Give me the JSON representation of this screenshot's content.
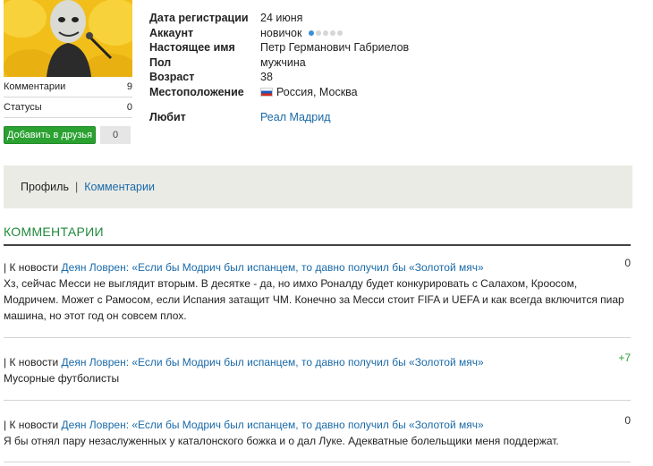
{
  "profile": {
    "stats": [
      {
        "label": "Комментарии",
        "value": "9"
      },
      {
        "label": "Статусы",
        "value": "0"
      }
    ],
    "add_friend_label": "Добавить в друзья",
    "add_friend_count": "0",
    "info": [
      {
        "key": "Дата регистрации",
        "value": "24 июня"
      },
      {
        "key": "Аккаунт",
        "value": "новичок"
      },
      {
        "key": "Настоящее имя",
        "value": "Петр Германович Габриелов"
      },
      {
        "key": "Пол",
        "value": "мужчина"
      },
      {
        "key": "Возраст",
        "value": "38"
      },
      {
        "key": "Местоположение",
        "value": "Россия, Москва"
      }
    ],
    "account_level": {
      "filled": 1,
      "total": 5
    },
    "likes_label": "Любит",
    "likes_value": "Реал Мадрид",
    "colors": {
      "accent_green": "#2aa131",
      "link_blue": "#1a6aa8"
    }
  },
  "tabs": {
    "profile": "Профиль",
    "separator": "|",
    "comments": "Комментарии"
  },
  "section_title": "КОММЕНТАРИИ",
  "comments": [
    {
      "prefix": "| К новости",
      "link": "Деян Ловрен: «Если бы Модрич был испанцем, то давно получил бы «Золотой мяч»",
      "text": "Хз, сейчас Месси не выглядит вторым. В десятке - да, но имхо Роналду будет конкурировать с Салахом, Кроосом, Модричем. Может с Рамосом, если Испания затащит ЧМ. Конечно за Месси стоит FIFA и UEFA и как всегда включится пиар машина, но этот год он совсем плох.",
      "score": "0"
    },
    {
      "prefix": "| К новости",
      "link": "Деян Ловрен: «Если бы Модрич был испанцем, то давно получил бы «Золотой мяч»",
      "text": "Мусорные футболисты",
      "score": "+7"
    },
    {
      "prefix": "| К новости",
      "link": "Деян Ловрен: «Если бы Модрич был испанцем, то давно получил бы «Золотой мяч»",
      "text": "Я бы отнял пару незаслуженных у каталонского божка и о дал Луке. Адекватные болельщики меня поддержат.",
      "score": "0"
    }
  ]
}
